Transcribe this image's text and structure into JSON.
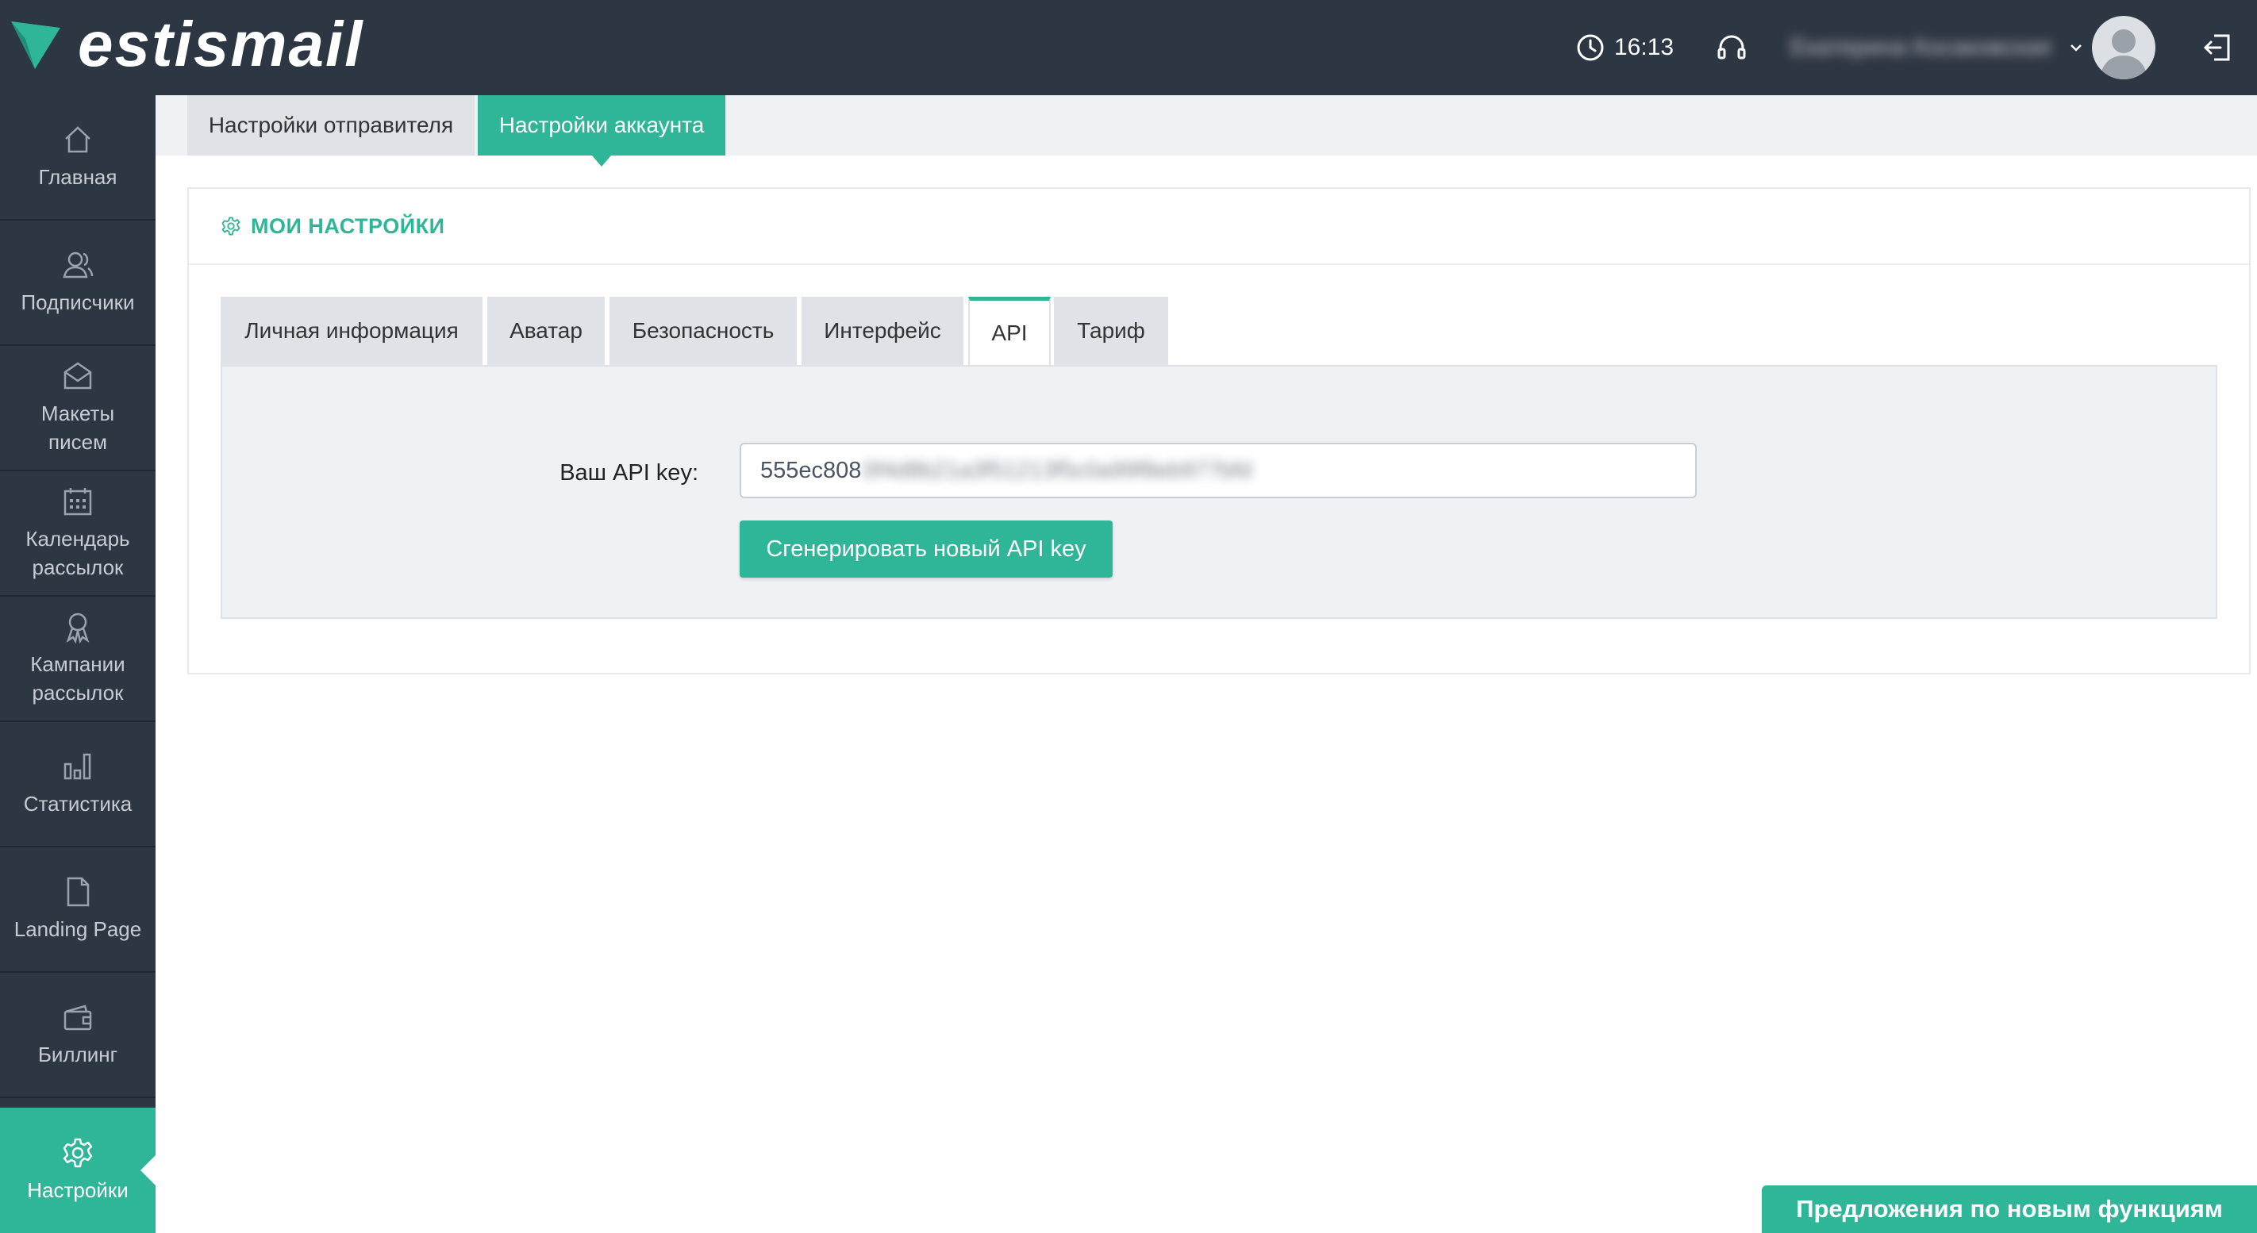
{
  "app": {
    "logo_text": "estismail"
  },
  "header": {
    "time": "16:13",
    "user_name": "Екатерина Косаковская",
    "icons": {
      "clock": "clock-icon",
      "support": "headset-icon",
      "logout": "logout-icon"
    }
  },
  "sidebar": {
    "items": [
      {
        "label": "Главная",
        "icon": "home-icon"
      },
      {
        "label": "Подписчики",
        "icon": "users-icon"
      },
      {
        "label": "Макеты\nписем",
        "icon": "envelope-icon"
      },
      {
        "label": "Календарь\nрассылок",
        "icon": "calendar-icon"
      },
      {
        "label": "Кампании\nрассылок",
        "icon": "award-icon"
      },
      {
        "label": "Статистика",
        "icon": "bar-chart-icon"
      },
      {
        "label": "Landing Page",
        "icon": "page-icon"
      },
      {
        "label": "Биллинг",
        "icon": "wallet-icon"
      },
      {
        "label": "Настройки",
        "icon": "gear-icon",
        "active": true
      }
    ]
  },
  "top_tabs": [
    {
      "label": "Настройки отправителя"
    },
    {
      "label": "Настройки аккаунта",
      "active": true
    }
  ],
  "panel": {
    "title": "МОИ НАСТРОЙКИ",
    "tabs": [
      {
        "label": "Личная информация"
      },
      {
        "label": "Аватар"
      },
      {
        "label": "Безопасность"
      },
      {
        "label": "Интерфейс"
      },
      {
        "label": "API",
        "active": true
      },
      {
        "label": "Тариф"
      }
    ],
    "api": {
      "label": "Ваш API key:",
      "key_visible": "555ec808",
      "key_hidden": "0f4d8b21a3f51213f5c0a99f8eb977bfd",
      "generate_button": "Сгенерировать новый API key"
    }
  },
  "feedback_button": "Предложения по новым функциям",
  "colors": {
    "accent": "#2fb597",
    "header_bg": "#2d3643",
    "content_bg": "#eff2f5"
  }
}
